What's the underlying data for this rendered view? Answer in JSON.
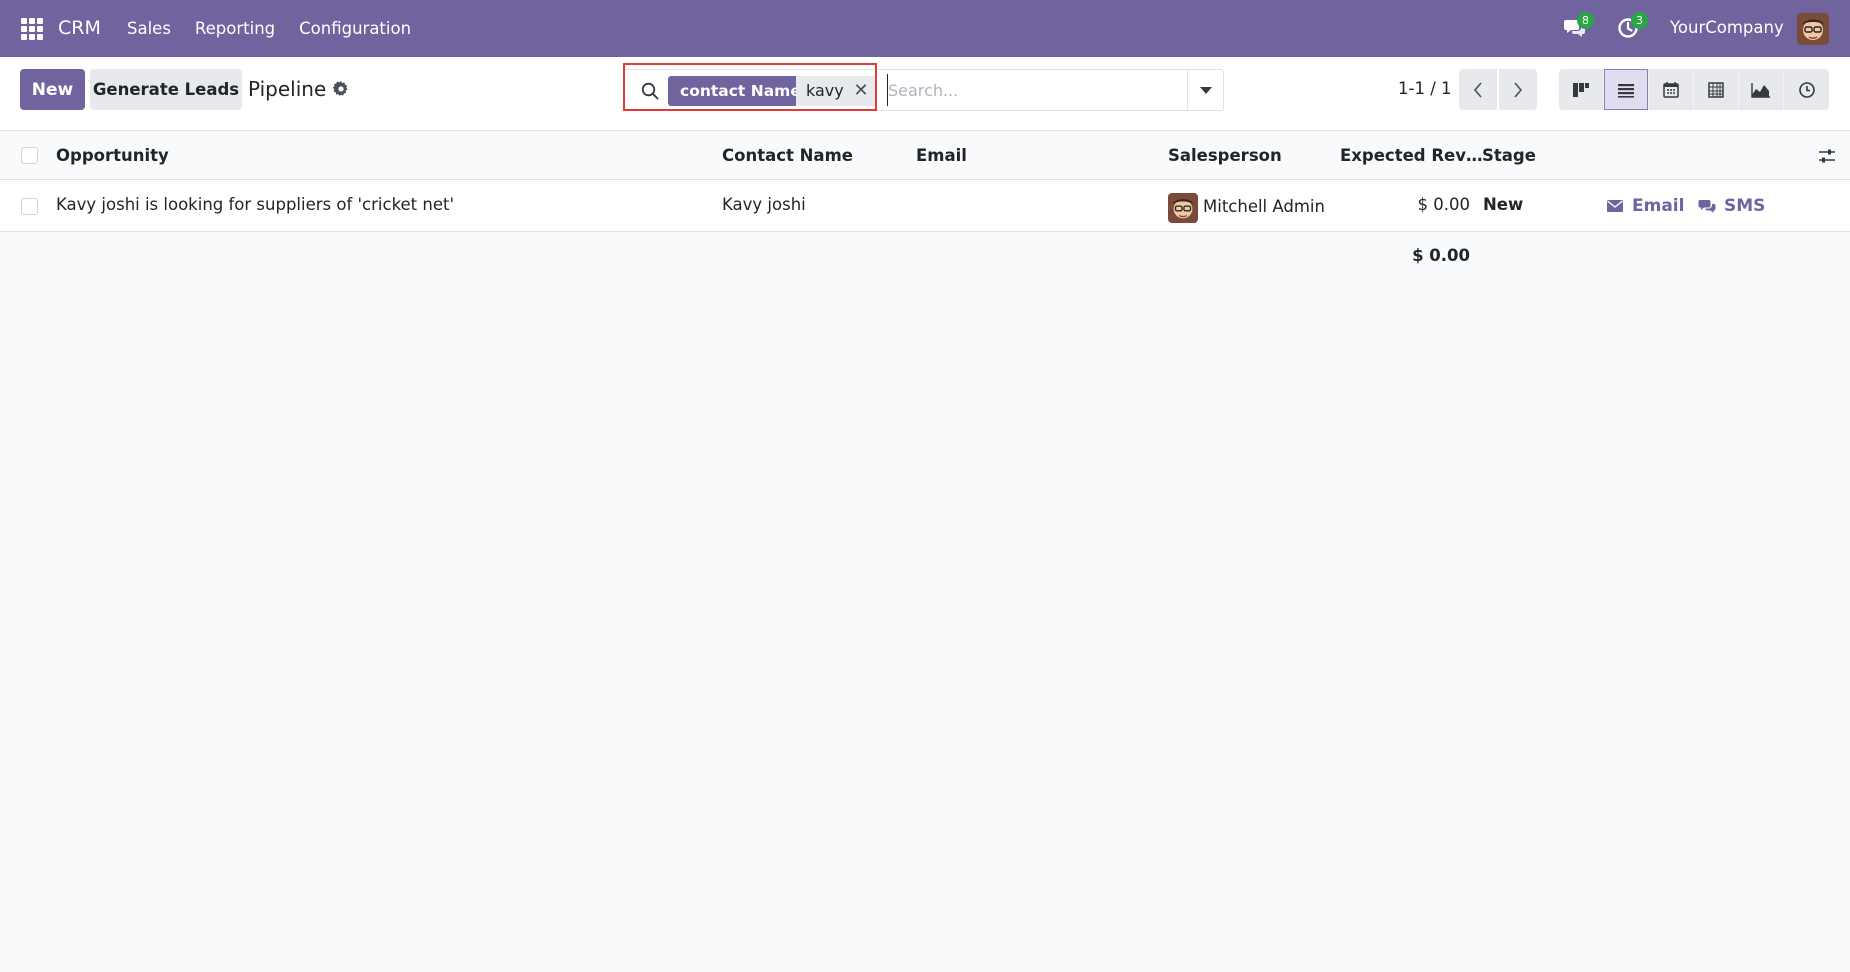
{
  "navbar": {
    "brand": "CRM",
    "menu": [
      "Sales",
      "Reporting",
      "Configuration"
    ],
    "messages_count": "8",
    "activities_count": "3",
    "company": "YourCompany",
    "color": "#71639e"
  },
  "control": {
    "new_label": "New",
    "generate_label": "Generate Leads",
    "title": "Pipeline",
    "search": {
      "facet_label": "contact Name",
      "facet_value": "kavy",
      "placeholder": "Search..."
    },
    "pager": "1-1 / 1",
    "views": [
      "kanban-icon",
      "list-icon",
      "calendar-icon",
      "pivot-icon",
      "graph-icon",
      "activity-icon"
    ],
    "active_view": "list-icon"
  },
  "table": {
    "columns": [
      "Opportunity",
      "Contact Name",
      "Email",
      "Salesperson",
      "Expected Rev…",
      "Stage"
    ],
    "rows": [
      {
        "opportunity": "Kavy joshi is looking for suppliers of 'cricket net'",
        "contact": "Kavy joshi",
        "email": "",
        "salesperson": "Mitchell Admin",
        "revenue": "$ 0.00",
        "stage": "New",
        "email_action": "Email",
        "sms_action": "SMS"
      }
    ],
    "total_revenue": "$ 0.00"
  }
}
